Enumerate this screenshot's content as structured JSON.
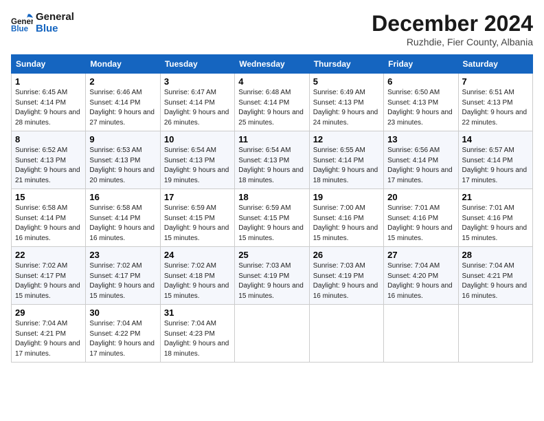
{
  "header": {
    "logo_line1": "General",
    "logo_line2": "Blue",
    "month_title": "December 2024",
    "location": "Ruzhdie, Fier County, Albania"
  },
  "weekdays": [
    "Sunday",
    "Monday",
    "Tuesday",
    "Wednesday",
    "Thursday",
    "Friday",
    "Saturday"
  ],
  "weeks": [
    [
      {
        "day": "1",
        "sunrise": "6:45 AM",
        "sunset": "4:14 PM",
        "daylight": "9 hours and 28 minutes."
      },
      {
        "day": "2",
        "sunrise": "6:46 AM",
        "sunset": "4:14 PM",
        "daylight": "9 hours and 27 minutes."
      },
      {
        "day": "3",
        "sunrise": "6:47 AM",
        "sunset": "4:14 PM",
        "daylight": "9 hours and 26 minutes."
      },
      {
        "day": "4",
        "sunrise": "6:48 AM",
        "sunset": "4:14 PM",
        "daylight": "9 hours and 25 minutes."
      },
      {
        "day": "5",
        "sunrise": "6:49 AM",
        "sunset": "4:13 PM",
        "daylight": "9 hours and 24 minutes."
      },
      {
        "day": "6",
        "sunrise": "6:50 AM",
        "sunset": "4:13 PM",
        "daylight": "9 hours and 23 minutes."
      },
      {
        "day": "7",
        "sunrise": "6:51 AM",
        "sunset": "4:13 PM",
        "daylight": "9 hours and 22 minutes."
      }
    ],
    [
      {
        "day": "8",
        "sunrise": "6:52 AM",
        "sunset": "4:13 PM",
        "daylight": "9 hours and 21 minutes."
      },
      {
        "day": "9",
        "sunrise": "6:53 AM",
        "sunset": "4:13 PM",
        "daylight": "9 hours and 20 minutes."
      },
      {
        "day": "10",
        "sunrise": "6:54 AM",
        "sunset": "4:13 PM",
        "daylight": "9 hours and 19 minutes."
      },
      {
        "day": "11",
        "sunrise": "6:54 AM",
        "sunset": "4:13 PM",
        "daylight": "9 hours and 18 minutes."
      },
      {
        "day": "12",
        "sunrise": "6:55 AM",
        "sunset": "4:14 PM",
        "daylight": "9 hours and 18 minutes."
      },
      {
        "day": "13",
        "sunrise": "6:56 AM",
        "sunset": "4:14 PM",
        "daylight": "9 hours and 17 minutes."
      },
      {
        "day": "14",
        "sunrise": "6:57 AM",
        "sunset": "4:14 PM",
        "daylight": "9 hours and 17 minutes."
      }
    ],
    [
      {
        "day": "15",
        "sunrise": "6:58 AM",
        "sunset": "4:14 PM",
        "daylight": "9 hours and 16 minutes."
      },
      {
        "day": "16",
        "sunrise": "6:58 AM",
        "sunset": "4:14 PM",
        "daylight": "9 hours and 16 minutes."
      },
      {
        "day": "17",
        "sunrise": "6:59 AM",
        "sunset": "4:15 PM",
        "daylight": "9 hours and 15 minutes."
      },
      {
        "day": "18",
        "sunrise": "6:59 AM",
        "sunset": "4:15 PM",
        "daylight": "9 hours and 15 minutes."
      },
      {
        "day": "19",
        "sunrise": "7:00 AM",
        "sunset": "4:16 PM",
        "daylight": "9 hours and 15 minutes."
      },
      {
        "day": "20",
        "sunrise": "7:01 AM",
        "sunset": "4:16 PM",
        "daylight": "9 hours and 15 minutes."
      },
      {
        "day": "21",
        "sunrise": "7:01 AM",
        "sunset": "4:16 PM",
        "daylight": "9 hours and 15 minutes."
      }
    ],
    [
      {
        "day": "22",
        "sunrise": "7:02 AM",
        "sunset": "4:17 PM",
        "daylight": "9 hours and 15 minutes."
      },
      {
        "day": "23",
        "sunrise": "7:02 AM",
        "sunset": "4:17 PM",
        "daylight": "9 hours and 15 minutes."
      },
      {
        "day": "24",
        "sunrise": "7:02 AM",
        "sunset": "4:18 PM",
        "daylight": "9 hours and 15 minutes."
      },
      {
        "day": "25",
        "sunrise": "7:03 AM",
        "sunset": "4:19 PM",
        "daylight": "9 hours and 15 minutes."
      },
      {
        "day": "26",
        "sunrise": "7:03 AM",
        "sunset": "4:19 PM",
        "daylight": "9 hours and 16 minutes."
      },
      {
        "day": "27",
        "sunrise": "7:04 AM",
        "sunset": "4:20 PM",
        "daylight": "9 hours and 16 minutes."
      },
      {
        "day": "28",
        "sunrise": "7:04 AM",
        "sunset": "4:21 PM",
        "daylight": "9 hours and 16 minutes."
      }
    ],
    [
      {
        "day": "29",
        "sunrise": "7:04 AM",
        "sunset": "4:21 PM",
        "daylight": "9 hours and 17 minutes."
      },
      {
        "day": "30",
        "sunrise": "7:04 AM",
        "sunset": "4:22 PM",
        "daylight": "9 hours and 17 minutes."
      },
      {
        "day": "31",
        "sunrise": "7:04 AM",
        "sunset": "4:23 PM",
        "daylight": "9 hours and 18 minutes."
      },
      null,
      null,
      null,
      null
    ]
  ],
  "labels": {
    "sunrise": "Sunrise:",
    "sunset": "Sunset:",
    "daylight": "Daylight:"
  }
}
